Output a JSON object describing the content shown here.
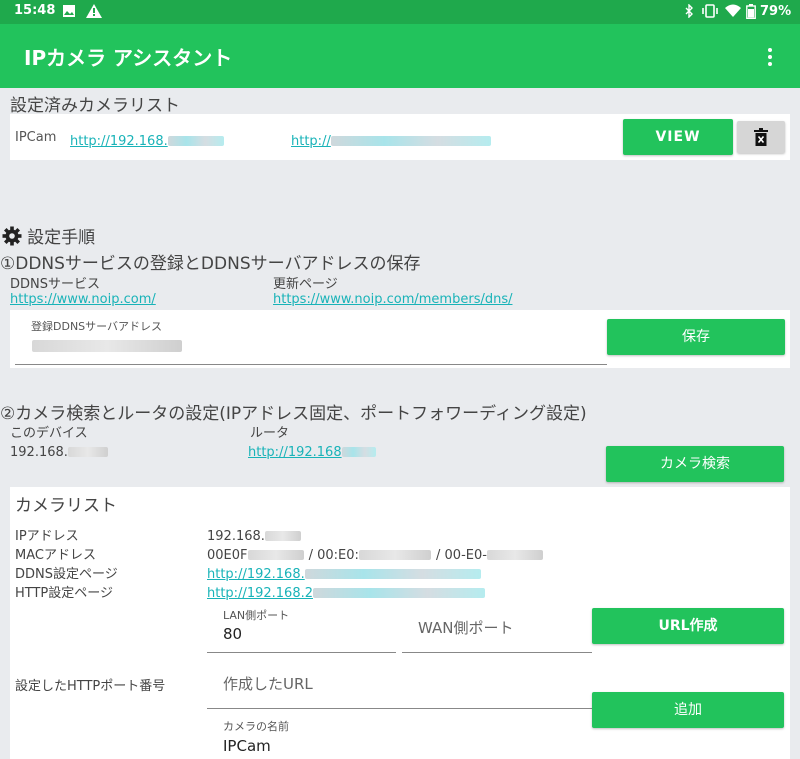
{
  "status_bar": {
    "time": "15:48",
    "battery": "79%"
  },
  "app_bar": {
    "title": "IPカメラ アシスタント"
  },
  "configured": {
    "heading": "設定済みカメラリスト",
    "camera_name": "IPCam",
    "link1_prefix": "http://192.168.",
    "link2_prefix": "http://",
    "view_label": "VIEW"
  },
  "procedure": {
    "heading": "設定手順"
  },
  "step1": {
    "heading": "①DDNSサービスの登録とDDNSサーバアドレスの保存",
    "service_label": "DDNSサービス",
    "service_url": "https://www.noip.com/",
    "update_label": "更新ページ",
    "update_url": "https://www.noip.com/members/dns/",
    "field_label": "登録DDNSサーバアドレス",
    "save_label": "保存"
  },
  "step2": {
    "heading": "②カメラ検索とルータの設定(IPアドレス固定、ポートフォワーディング設定)",
    "device_label": "このデバイス",
    "device_ip_prefix": "192.168.",
    "router_label": "ルータ",
    "router_url_prefix": "http://192.168",
    "search_label": "カメラ検索"
  },
  "camera_list": {
    "heading": "カメラリスト",
    "ip_label": "IPアドレス",
    "ip_value_prefix": "192.168.",
    "mac_label": "MACアドレス",
    "mac_value_1": "00E0F",
    "mac_value_2": "/ 00:E0:",
    "mac_value_3": "/ 00-E0-",
    "ddns_label": "DDNS設定ページ",
    "ddns_url_prefix": "http://192.168.",
    "http_label": "HTTP設定ページ",
    "http_url_prefix": "http://192.168.2",
    "lan_port_label": "LAN側ポート",
    "lan_port_value": "80",
    "wan_port_placeholder": "WAN側ポート",
    "url_create_label": "URL作成",
    "http_port_label": "設定したHTTPポート番号",
    "created_url_placeholder": "作成したURL",
    "add_label": "追加",
    "camera_name_label": "カメラの名前",
    "camera_name_value": "IPCam"
  }
}
